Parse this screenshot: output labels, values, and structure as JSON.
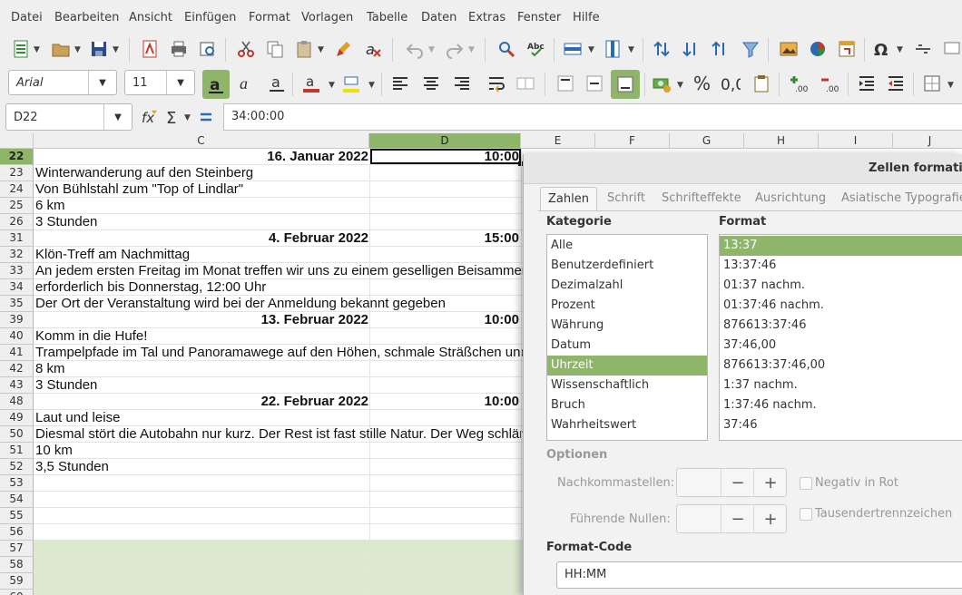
{
  "menu": [
    "Datei",
    "Bearbeiten",
    "Ansicht",
    "Einfügen",
    "Format",
    "Vorlagen",
    "Tabelle",
    "Daten",
    "Extras",
    "Fenster",
    "Hilfe"
  ],
  "toolbar": {
    "font_name": "Arial",
    "font_size": "11"
  },
  "formula_bar": {
    "cell_ref": "D22",
    "formula": "34:00:00"
  },
  "sheet": {
    "columns": [
      "C",
      "D",
      "E",
      "F",
      "G",
      "H",
      "I",
      "J"
    ],
    "selected_column": "D",
    "rows": [
      {
        "num": "22",
        "c": "16. Januar 2022",
        "d": "10:00",
        "bold": true,
        "selected": true
      },
      {
        "num": "23",
        "c": "Winterwanderung auf den Steinberg"
      },
      {
        "num": "24",
        "c": "Von Bühlstahl zum \"Top of Lindlar\""
      },
      {
        "num": "25",
        "c": "6 km"
      },
      {
        "num": "26",
        "c": "3 Stunden"
      },
      {
        "num": "31",
        "c": "4. Februar 2022",
        "d": "15:00",
        "bold": true
      },
      {
        "num": "32",
        "c": "Klön-Treff am Nachmittag"
      },
      {
        "num": "33",
        "c": "An jedem ersten Freitag im Monat treffen wir uns zu einem geselligen Beisammensei"
      },
      {
        "num": "34",
        "c": "erforderlich bis Donnerstag, 12:00 Uhr"
      },
      {
        "num": "35",
        "c": "Der Ort der Veranstaltung wird bei der Anmeldung bekannt gegeben"
      },
      {
        "num": "39",
        "c": "13. Februar 2022",
        "d": "10:00",
        "bold": true
      },
      {
        "num": "40",
        "c": "Komm in die Hufe!"
      },
      {
        "num": "41",
        "c": "Trampelpfade im Tal und Panoramawege auf den Höhen, schmale Sträßchen und ein"
      },
      {
        "num": "42",
        "c": "8 km"
      },
      {
        "num": "43",
        "c": "3 Stunden"
      },
      {
        "num": "48",
        "c": "22. Februar 2022",
        "d": "10:00",
        "bold": true
      },
      {
        "num": "49",
        "c": "Laut und leise"
      },
      {
        "num": "50",
        "c": "Diesmal stört die Autobahn nur kurz. Der Rest ist fast stille Natur. Der Weg schlänge"
      },
      {
        "num": "51",
        "c": "10 km"
      },
      {
        "num": "52",
        "c": "3,5 Stunden"
      },
      {
        "num": "53",
        "c": ""
      },
      {
        "num": "54",
        "c": ""
      },
      {
        "num": "55",
        "c": ""
      },
      {
        "num": "56",
        "c": ""
      },
      {
        "num": "57",
        "c": "",
        "shaded": true
      },
      {
        "num": "58",
        "c": "",
        "shaded": true
      },
      {
        "num": "59",
        "c": "",
        "shaded": true
      },
      {
        "num": "60",
        "c": "",
        "shaded": true
      }
    ]
  },
  "dialog": {
    "title": "Zellen formatiere",
    "tabs": [
      "Zahlen",
      "Schrift",
      "Schrifteffekte",
      "Ausrichtung",
      "Asiatische Typografie"
    ],
    "active_tab": "Zahlen",
    "category_label": "Kategorie",
    "categories": [
      "Alle",
      "Benutzerdefiniert",
      "Dezimalzahl",
      "Prozent",
      "Währung",
      "Datum",
      "Uhrzeit",
      "Wissenschaftlich",
      "Bruch",
      "Wahrheitswert"
    ],
    "selected_category": "Uhrzeit",
    "format_label": "Format",
    "formats": [
      "13:37",
      "13:37:46",
      "01:37 nachm.",
      "01:37:46 nachm.",
      "876613:37:46",
      "37:46,00",
      "876613:37:46,00",
      "1:37 nachm.",
      "1:37:46 nachm.",
      "37:46"
    ],
    "selected_format": "13:37",
    "options_label": "Optionen",
    "decimals_label": "Nachkommastellen:",
    "leading_zeros_label": "Führende Nullen:",
    "negative_red_label": "Negativ in Rot",
    "thousands_label": "Tausendertrennzeichen",
    "format_code_label": "Format-Code",
    "format_code": "HH:MM"
  },
  "colors": {
    "accent": "#8fb56a"
  }
}
